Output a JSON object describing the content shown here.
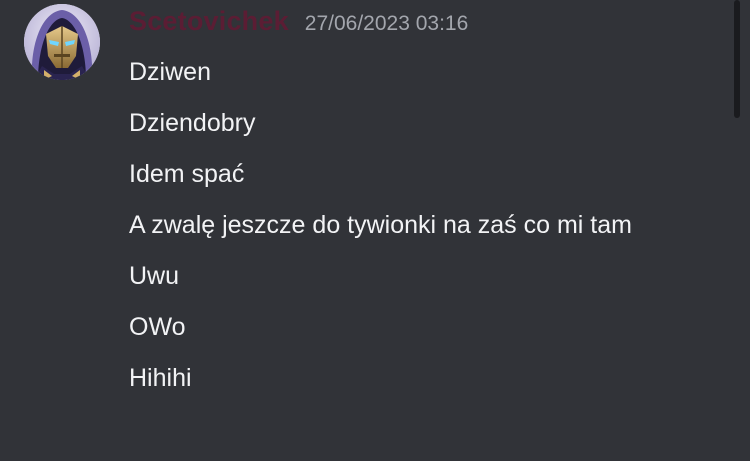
{
  "message_group": {
    "author": {
      "username": "Scetovichek",
      "avatar_icon": "hooded-robot-avatar",
      "username_color": "#5b1d34"
    },
    "timestamp": "27/06/2023 03:16",
    "messages": [
      "Dziwen",
      "Dziendobry",
      "Idem spać",
      "A zwalę jeszcze do tywionki na zaś co mi tam",
      "Uwu",
      "OWo",
      "Hihihi"
    ]
  },
  "colors": {
    "background": "#313338",
    "message_text": "#f2f3f5",
    "timestamp": "#a3a6ad"
  }
}
